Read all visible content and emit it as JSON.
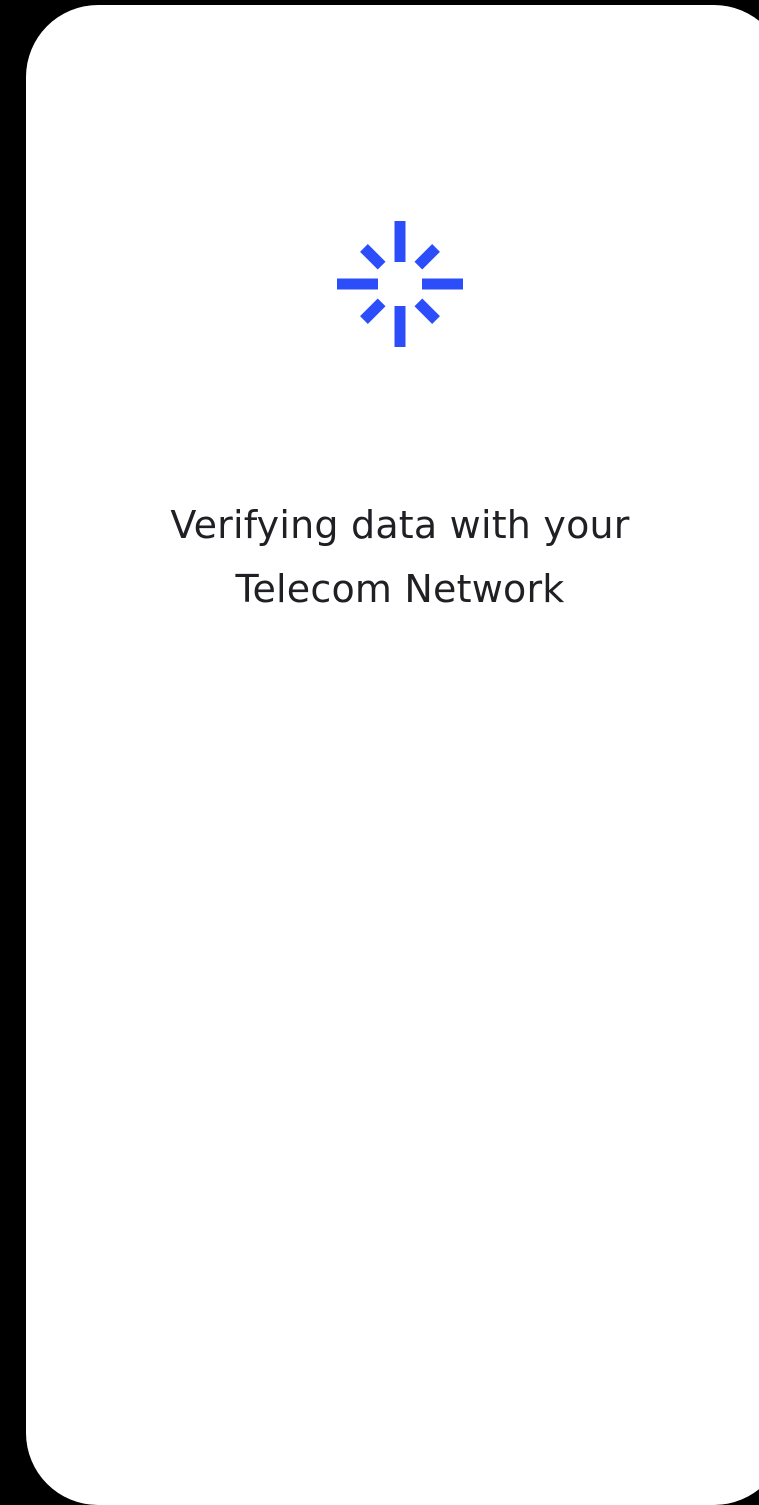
{
  "loading": {
    "icon": "loading-spinner-icon",
    "accent_color": "#2b4dfa",
    "message_line1": "Verifying data with your",
    "message_line2": "Telecom Network"
  }
}
